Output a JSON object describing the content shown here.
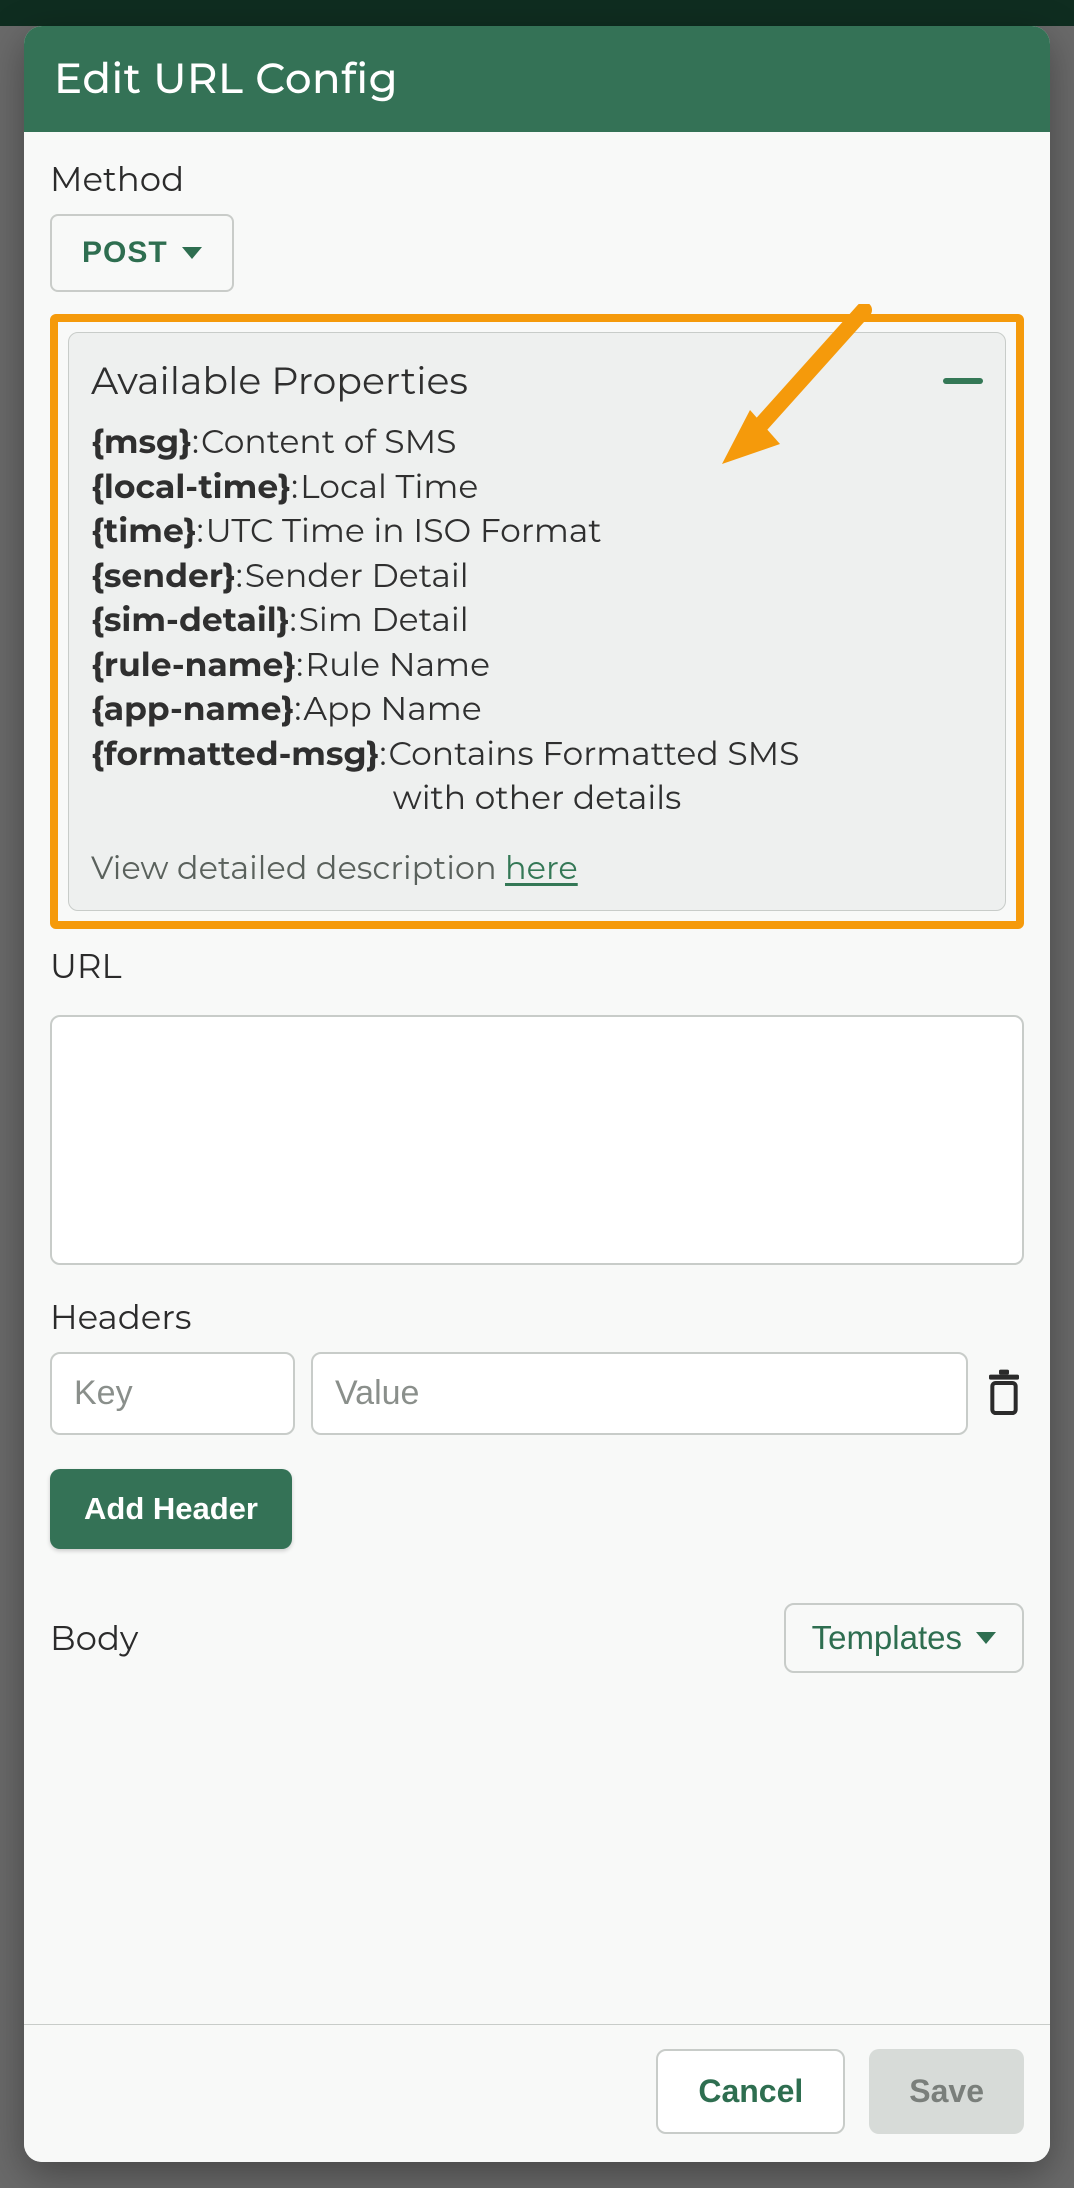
{
  "dialog": {
    "title": "Edit URL Config"
  },
  "method": {
    "label": "Method",
    "value": "POST"
  },
  "properties": {
    "title": "Available Properties",
    "items": [
      {
        "key": "{msg}",
        "desc": "Content of SMS"
      },
      {
        "key": "{local-time}",
        "desc": "Local Time"
      },
      {
        "key": "{time}",
        "desc": "UTC Time in ISO Format"
      },
      {
        "key": "{sender}",
        "desc": "Sender Detail"
      },
      {
        "key": "{sim-detail}",
        "desc": "Sim Detail"
      },
      {
        "key": "{rule-name}",
        "desc": "Rule Name"
      },
      {
        "key": "{app-name}",
        "desc": "App Name"
      },
      {
        "key": "{formatted-msg}",
        "desc": "Contains Formatted SMS",
        "desc2": "with other details"
      }
    ],
    "footer_pre": "View detailed description ",
    "footer_link": "here"
  },
  "url": {
    "label": "URL",
    "value": ""
  },
  "headers": {
    "label": "Headers",
    "key_placeholder": "Key",
    "value_placeholder": "Value",
    "add_label": "Add Header"
  },
  "body": {
    "label": "Body",
    "templates_label": "Templates"
  },
  "footer": {
    "cancel": "Cancel",
    "save": "Save"
  }
}
